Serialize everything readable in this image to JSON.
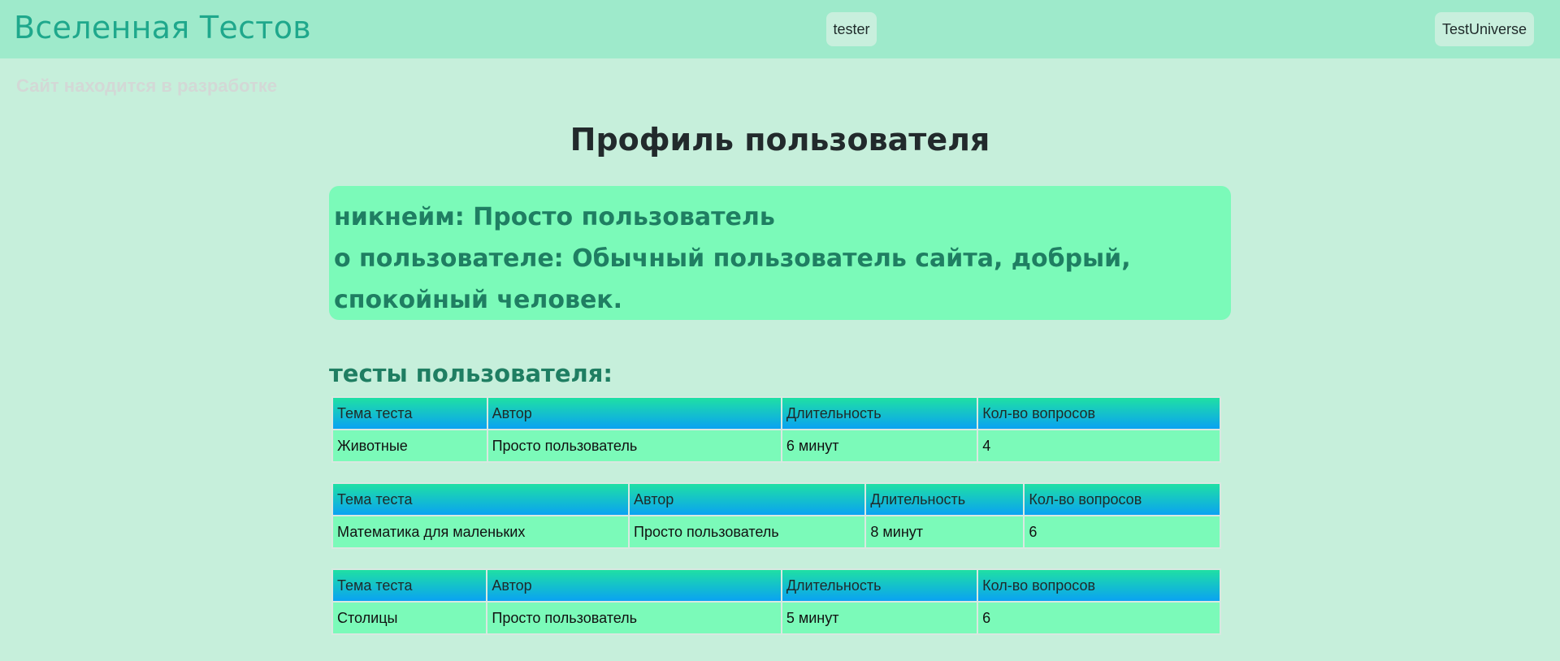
{
  "header": {
    "brand": "Вселенная Тестов",
    "user_button": "tester",
    "site_button": "TestUniverse"
  },
  "notice": "Сайт находится в разработке",
  "page_title": "Профиль пользователя",
  "profile": {
    "nickname_line": "никнейм: Просто пользователь",
    "about_line": "о пользователе: Обычный пользователь сайта, добрый, спокойный человек."
  },
  "tests_heading": "тесты пользователя:",
  "table_headers": {
    "topic": "Тема теста",
    "author": "Автор",
    "duration": "Длительность",
    "questions": "Кол-во вопросов"
  },
  "tests": [
    {
      "topic": "Животные",
      "author": "Просто пользователь",
      "duration": "6 минут",
      "questions": "4"
    },
    {
      "topic": "Математика для маленьких",
      "author": "Просто пользователь",
      "duration": "8 минут",
      "questions": "6"
    },
    {
      "topic": "Столицы",
      "author": "Просто пользователь",
      "duration": "5 минут",
      "questions": "6"
    }
  ]
}
